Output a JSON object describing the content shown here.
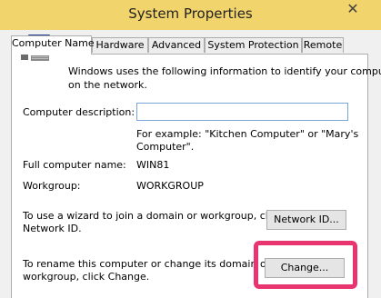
{
  "window": {
    "title": "System Properties",
    "close_glyph": "✕"
  },
  "tabs": [
    {
      "label": "Computer Name"
    },
    {
      "label": "Hardware"
    },
    {
      "label": "Advanced"
    },
    {
      "label": "System Protection"
    },
    {
      "label": "Remote"
    }
  ],
  "intro": {
    "line1": "Windows uses the following information to identify your computer",
    "line2": "on the network."
  },
  "description": {
    "label": "Computer description:",
    "value": "",
    "example_line1": "For example: \"Kitchen Computer\" or \"Mary's",
    "example_line2": "Computer\"."
  },
  "full_name": {
    "label": "Full computer name:",
    "value": "WIN81"
  },
  "workgroup": {
    "label": "Workgroup:",
    "value": "WORKGROUP"
  },
  "network_id": {
    "text_line1": "To use a wizard to join a domain or workgroup, click",
    "text_line2": "Network ID.",
    "button_label": "Network ID..."
  },
  "change": {
    "text_line1": "To rename this computer or change its domain or",
    "text_line2": "workgroup, click Change.",
    "button_label": "Change..."
  },
  "icons": {
    "computer": "computer-icon"
  },
  "colors": {
    "title_bar": "#f2d46d",
    "highlight": "#e8356f",
    "input_border": "#7aa7d8"
  }
}
